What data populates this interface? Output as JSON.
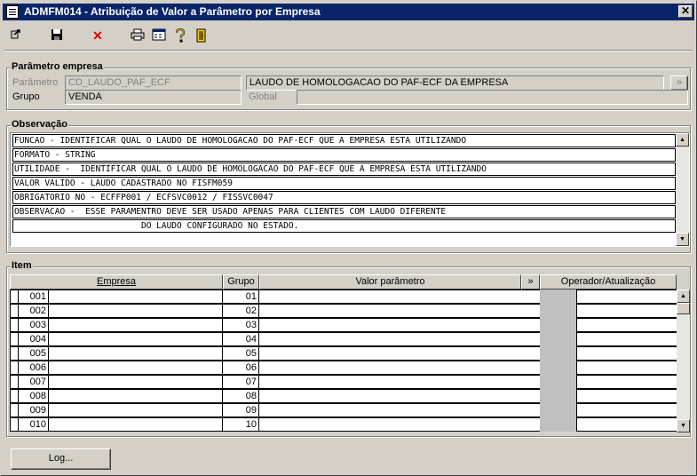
{
  "window": {
    "title": "ADMFM014 - Atribuição de Valor a Parâmetro por Empresa",
    "close_glyph": "✕"
  },
  "toolbar": {
    "icons": [
      "exit-arrow-icon",
      "save-icon",
      "delete-icon",
      "print-icon",
      "calculator-icon",
      "help-icon",
      "door-exit-icon"
    ]
  },
  "parametro_empresa": {
    "group_label": "Parâmetro empresa",
    "parametro_label": "Parâmetro",
    "parametro_value": "CD_LAUDO_PAF_ECF",
    "parametro_desc": "LAUDO DE HOMOLOGACAO DO PAF-ECF DA EMPRESA",
    "lookup_glyph": "»",
    "grupo_label": "Grupo",
    "grupo_value": "VENDA",
    "global_label": "Global",
    "global_value": ""
  },
  "observacao": {
    "group_label": "Observação",
    "lines": [
      "FUNCAO - IDENTIFICAR QUAL O LAUDO DE HOMOLOGACAO DO PAF-ECF QUE A EMPRESA ESTA UTILIZANDO",
      "FORMATO - STRING",
      "UTILIDADE -  IDENTIFICAR QUAL O LAUDO DE HOMOLOGACAO DO PAF-ECF QUE A EMPRESA ESTA UTILIZANDO",
      "VALOR VALIDO - LAUDO CADASTRADO NO FISFM059",
      "OBRIGATORIO NO - ECFFP001 / ECFSVC0012 / FISSVC0047",
      "OBSERVACAO -  ESSE PARAMENTRO DEVE SER USADO APENAS PARA CLIENTES COM LAUDO DIFERENTE",
      "                         DO LAUDO CONFIGURADO NO ESTADO."
    ]
  },
  "item": {
    "group_label": "Item",
    "columns": {
      "empresa": "Empresa",
      "grupo": "Grupo",
      "valor": "Valor parâmetro",
      "expand": "»",
      "operador": "Operador/Atualização"
    },
    "rows": [
      {
        "empresa": "001",
        "grupo": "01",
        "valor": "",
        "operador": ""
      },
      {
        "empresa": "002",
        "grupo": "02",
        "valor": "",
        "operador": ""
      },
      {
        "empresa": "003",
        "grupo": "03",
        "valor": "",
        "operador": ""
      },
      {
        "empresa": "004",
        "grupo": "04",
        "valor": "",
        "operador": ""
      },
      {
        "empresa": "005",
        "grupo": "05",
        "valor": "",
        "operador": ""
      },
      {
        "empresa": "006",
        "grupo": "06",
        "valor": "",
        "operador": ""
      },
      {
        "empresa": "007",
        "grupo": "07",
        "valor": "",
        "operador": ""
      },
      {
        "empresa": "008",
        "grupo": "08",
        "valor": "",
        "operador": ""
      },
      {
        "empresa": "009",
        "grupo": "09",
        "valor": "",
        "operador": ""
      },
      {
        "empresa": "010",
        "grupo": "10",
        "valor": "",
        "operador": ""
      }
    ]
  },
  "footer": {
    "log_button": "Log..."
  }
}
